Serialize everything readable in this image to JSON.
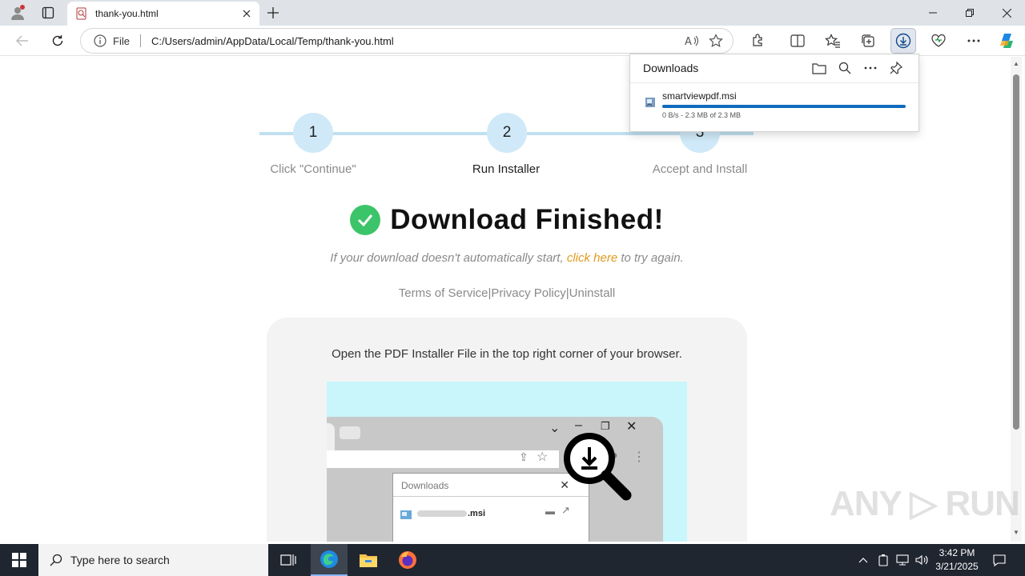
{
  "browser": {
    "tab_title": "thank-you.html",
    "address_scheme": "File",
    "url": "C:/Users/admin/AppData/Local/Temp/thank-you.html"
  },
  "downloads": {
    "title": "Downloads",
    "file_name": "smartviewpdf.msi",
    "status": "0 B/s - 2.3 MB of 2.3 MB",
    "progress": 1.0
  },
  "steps": [
    {
      "number": "1",
      "label": "Click \"Continue\""
    },
    {
      "number": "2",
      "label": "Run Installer"
    },
    {
      "number": "3",
      "label": "Accept and Install"
    }
  ],
  "main": {
    "heading": "Download Finished!",
    "retry_prefix": "If your download doesn't automatically start, ",
    "retry_link": "click here",
    "retry_suffix": " to try again.",
    "terms": "Terms of Service",
    "privacy": "Privacy Policy",
    "uninstall": "Uninstall",
    "separator": "|",
    "instruction": "Open the PDF Installer File in the top right corner of your browser."
  },
  "illustration": {
    "panel_title": "Downloads",
    "file_suffix": ".msi"
  },
  "watermark": "ANY RUN",
  "taskbar": {
    "search_placeholder": "Type here to search",
    "time": "3:42 PM",
    "date": "3/21/2025"
  },
  "colors": {
    "accent_blue": "#0f6cbd",
    "step_circle": "#cfe9f8",
    "check_green": "#3cc46a",
    "link_orange": "#e09a1c",
    "illustration_bg": "#c8f6fb"
  }
}
